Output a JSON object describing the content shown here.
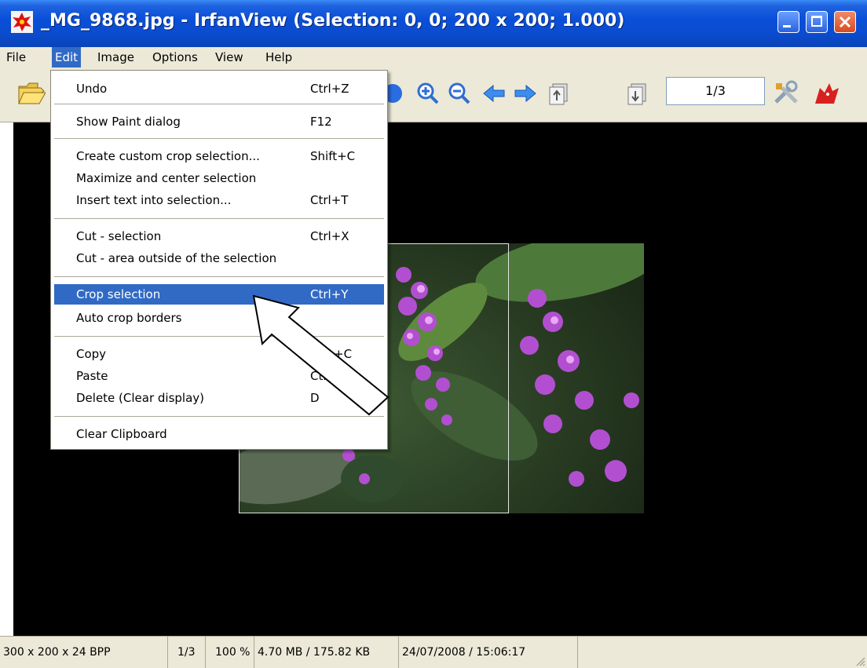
{
  "window": {
    "title": "_MG_9868.jpg - IrfanView (Selection: 0, 0; 200 x 200; 1.000)"
  },
  "menubar": {
    "items": [
      "File",
      "Edit",
      "Image",
      "Options",
      "View",
      "Help"
    ],
    "active": "Edit"
  },
  "toolbar": {
    "page_counter": "1/3"
  },
  "edit_menu": {
    "items": [
      {
        "label": "Undo",
        "shortcut": "Ctrl+Z"
      },
      {
        "label": "Show Paint dialog",
        "shortcut": "F12"
      },
      {
        "label": "Create custom crop selection...",
        "shortcut": "Shift+C"
      },
      {
        "label": "Maximize and center selection",
        "shortcut": ""
      },
      {
        "label": "Insert text into selection...",
        "shortcut": "Ctrl+T"
      },
      {
        "label": "Cut - selection",
        "shortcut": "Ctrl+X"
      },
      {
        "label": "Cut - area outside of the selection",
        "shortcut": ""
      },
      {
        "label": "Crop selection",
        "shortcut": "Ctrl+Y"
      },
      {
        "label": "Auto crop borders",
        "shortcut": ""
      },
      {
        "label": "Copy",
        "shortcut": "+C"
      },
      {
        "label": "Paste",
        "shortcut": "Ctr"
      },
      {
        "label": "Delete (Clear display)",
        "shortcut": "D"
      },
      {
        "label": "Clear Clipboard",
        "shortcut": ""
      }
    ],
    "highlighted": "Crop selection"
  },
  "statusbar": {
    "dimensions": "300 x 200 x 24 BPP",
    "page": "1/3",
    "zoom": "100 %",
    "memory": "4.70 MB / 175.82 KB",
    "datetime": "24/07/2008 / 15:06:17"
  },
  "colors": {
    "title_bar": "#0a4fd8",
    "menu_highlight": "#316ac5",
    "chrome": "#ece9d8"
  }
}
